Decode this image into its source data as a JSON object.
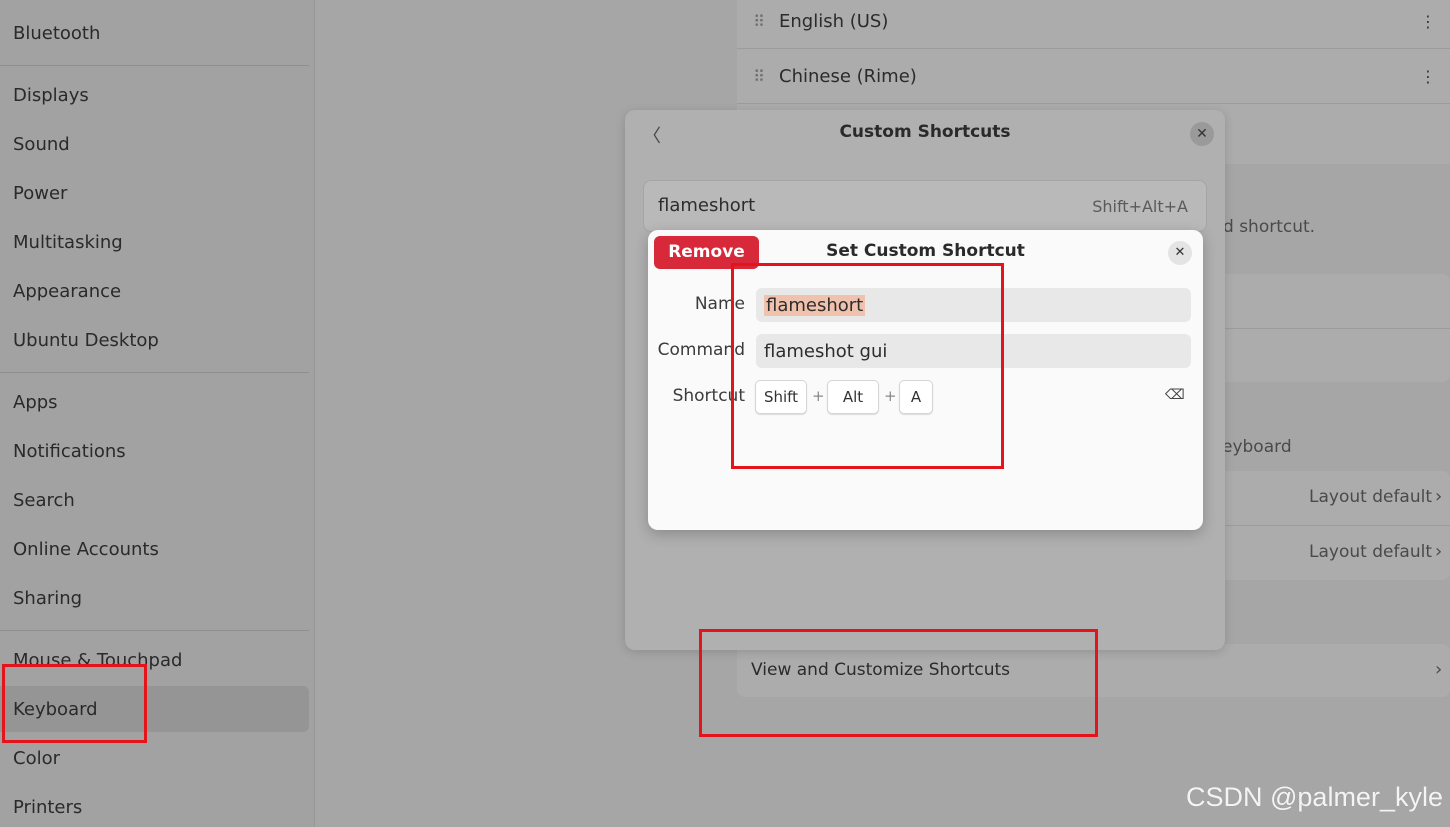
{
  "sidebar": {
    "items": [
      {
        "label": "Bluetooth"
      },
      {
        "label": "Displays"
      },
      {
        "label": "Sound"
      },
      {
        "label": "Power"
      },
      {
        "label": "Multitasking"
      },
      {
        "label": "Appearance"
      },
      {
        "label": "Ubuntu Desktop"
      },
      {
        "label": "Apps"
      },
      {
        "label": "Notifications"
      },
      {
        "label": "Search"
      },
      {
        "label": "Online Accounts"
      },
      {
        "label": "Sharing"
      },
      {
        "label": "Mouse & Touchpad"
      },
      {
        "label": "Keyboard"
      },
      {
        "label": "Color"
      },
      {
        "label": "Printers"
      }
    ],
    "active": "Keyboard"
  },
  "background": {
    "input_sources": [
      "English (US)",
      "Chinese (Rime)"
    ],
    "partial_shortcut_text": "d shortcut.",
    "partial_keyboard_text": "eyboard",
    "layout_rows": [
      "Layout default",
      "Layout default"
    ],
    "view_shortcuts_label": "View and Customize Shortcuts"
  },
  "custom_shortcuts_dialog": {
    "title": "Custom Shortcuts",
    "entry_name": "flameshort",
    "entry_accel": "Shift+Alt+A"
  },
  "set_shortcut_dialog": {
    "title": "Set Custom Shortcut",
    "remove_label": "Remove",
    "name_label": "Name",
    "name_value": "flameshort",
    "command_label": "Command",
    "command_value": "flameshot gui",
    "shortcut_label": "Shortcut",
    "keys": [
      "Shift",
      "Alt",
      "A"
    ],
    "plus": "+"
  },
  "icons": {
    "back": "chevron-left-icon",
    "close": "close-icon",
    "backspace": "backspace-icon",
    "drag": "drag-handle-icon",
    "menu": "kebab-menu-icon"
  },
  "colors": {
    "remove_button": "#d8293b",
    "annotation": "#e5141a",
    "selection_highlight": "#f0c1ad"
  },
  "watermark": "CSDN @palmer_kyle"
}
